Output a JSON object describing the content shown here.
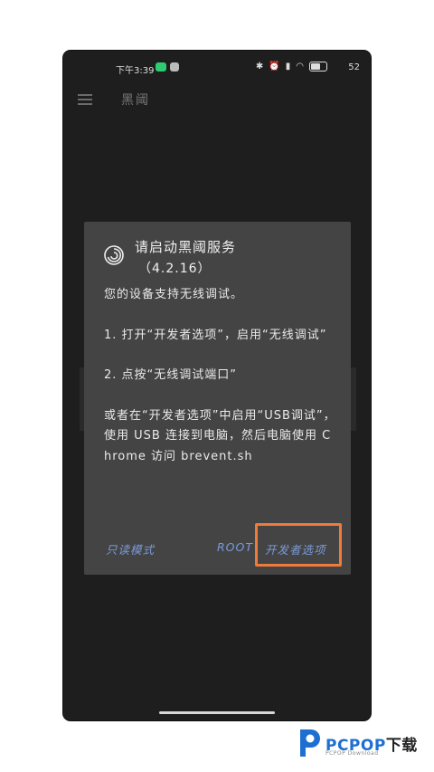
{
  "status_bar": {
    "time": "下午3:39",
    "battery": "52"
  },
  "app_bar": {
    "title": "黑阈"
  },
  "dialog": {
    "title": "请启动黑阈服务",
    "version": "（4.2.16）",
    "body": [
      "您的设备支持无线调试。",
      "1. 打开“开发者选项”，启用“无线调试”",
      "2. 点按“无线调试端口”",
      "或者在“开发者选项”中启用“USB调试”，使用 USB 连接到电脑，然后电脑使用 Chrome 访问 brevent.sh"
    ],
    "buttons": {
      "readonly": "只读模式",
      "root": "ROOT",
      "dev_options": "开发者选项"
    }
  },
  "watermark": {
    "brand": "PCPOP",
    "brand_suffix": "下载",
    "sub": "PCPOP Download"
  },
  "colors": {
    "dialog_bg": "#444444",
    "button_text": "#7a9ad8",
    "highlight": "#ef7b3a",
    "brand_blue": "#1f6fd1"
  }
}
